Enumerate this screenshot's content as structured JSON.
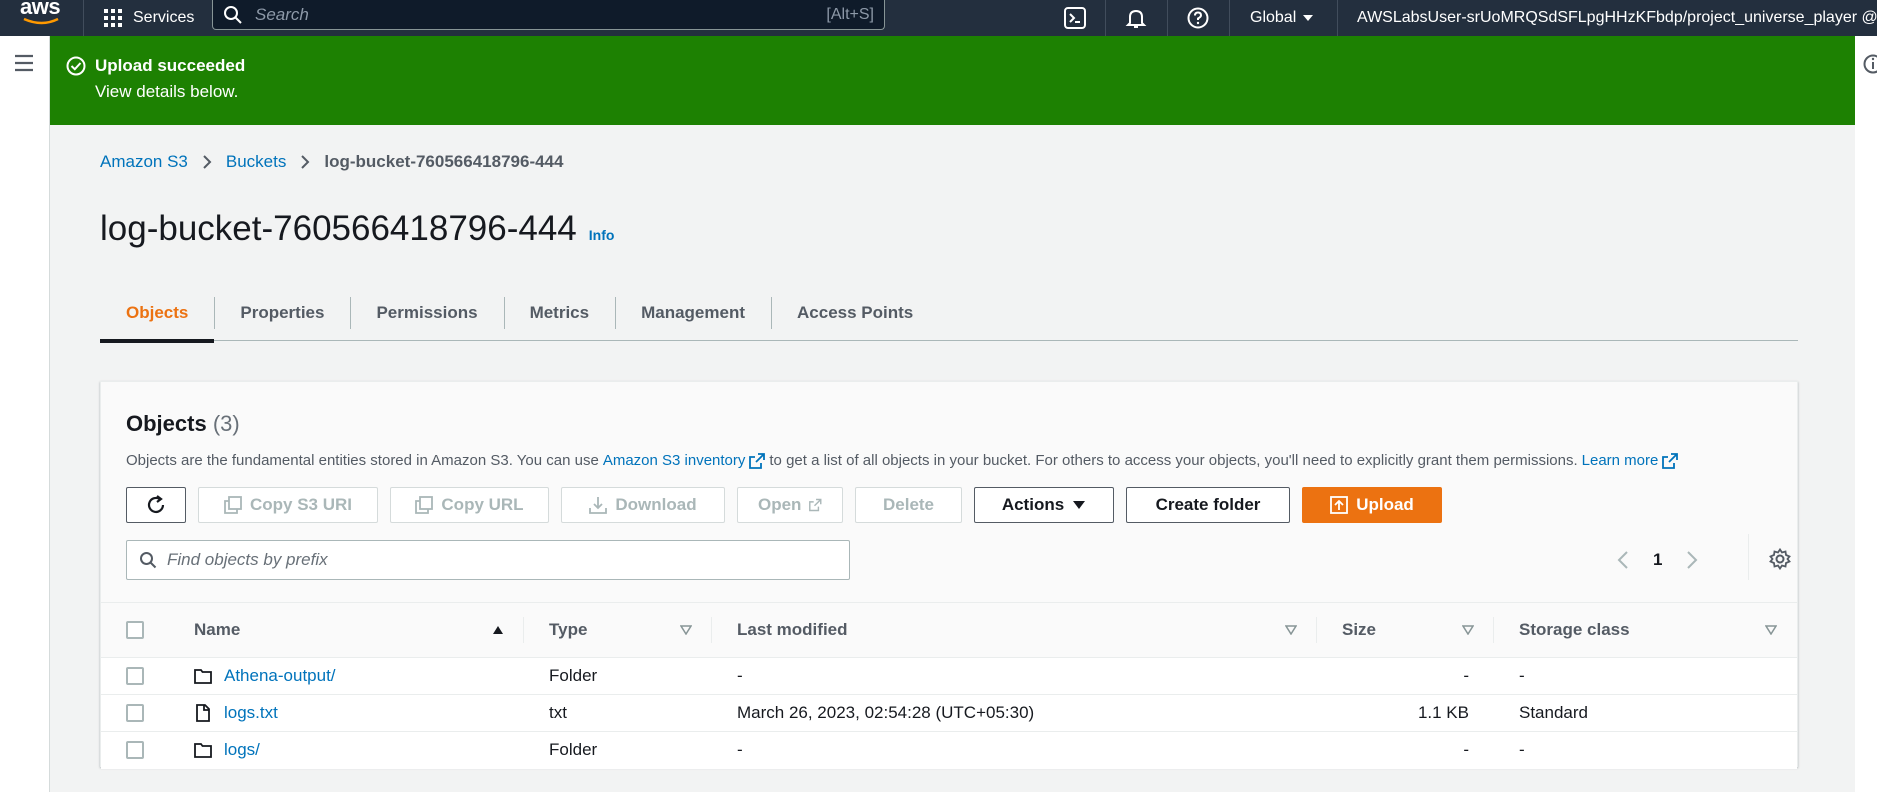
{
  "nav": {
    "logo": "aws",
    "services": "Services",
    "search_placeholder": "Search",
    "search_hint": "[Alt+S]",
    "region": "Global",
    "account": "AWSLabsUser-srUoMRQSdSFLpgHHzKFbdp/project_universe_player @ ..."
  },
  "flash": {
    "title": "Upload succeeded",
    "subtitle": "View details below."
  },
  "breadcrumb": {
    "items": [
      "Amazon S3",
      "Buckets"
    ],
    "current": "log-bucket-760566418796-444"
  },
  "page": {
    "title": "log-bucket-760566418796-444",
    "info": "Info"
  },
  "tabs": [
    "Objects",
    "Properties",
    "Permissions",
    "Metrics",
    "Management",
    "Access Points"
  ],
  "objects": {
    "title": "Objects",
    "count": "(3)",
    "desc_1": "Objects are the fundamental entities stored in Amazon S3. You can use",
    "desc_link": "Amazon S3 inventory",
    "desc_2": "to get a list of all objects in your bucket. For others to access your objects, you'll need to explicitly grant them permissions.",
    "learn_more": "Learn more",
    "buttons": {
      "copy_uri": "Copy S3 URI",
      "copy_url": "Copy URL",
      "download": "Download",
      "open": "Open",
      "delete": "Delete",
      "actions": "Actions",
      "create_folder": "Create folder",
      "upload": "Upload"
    },
    "find_placeholder": "Find objects by prefix",
    "page": "1",
    "columns": [
      "Name",
      "Type",
      "Last modified",
      "Size",
      "Storage class"
    ],
    "rows": [
      {
        "name": "Athena-output/",
        "type": "Folder",
        "modified": "-",
        "size": "-",
        "storage": "-",
        "icon": "folder-icon"
      },
      {
        "name": "logs.txt",
        "type": "txt",
        "modified": "March 26, 2023, 02:54:28 (UTC+05:30)",
        "size": "1.1 KB",
        "storage": "Standard",
        "icon": "file-icon"
      },
      {
        "name": "logs/",
        "type": "Folder",
        "modified": "-",
        "size": "-",
        "storage": "-",
        "icon": "folder-icon"
      }
    ]
  },
  "colors": {
    "nav_bg": "#232f3e",
    "success": "#1d8102",
    "accent": "#ec7211",
    "link": "#0073bb"
  }
}
